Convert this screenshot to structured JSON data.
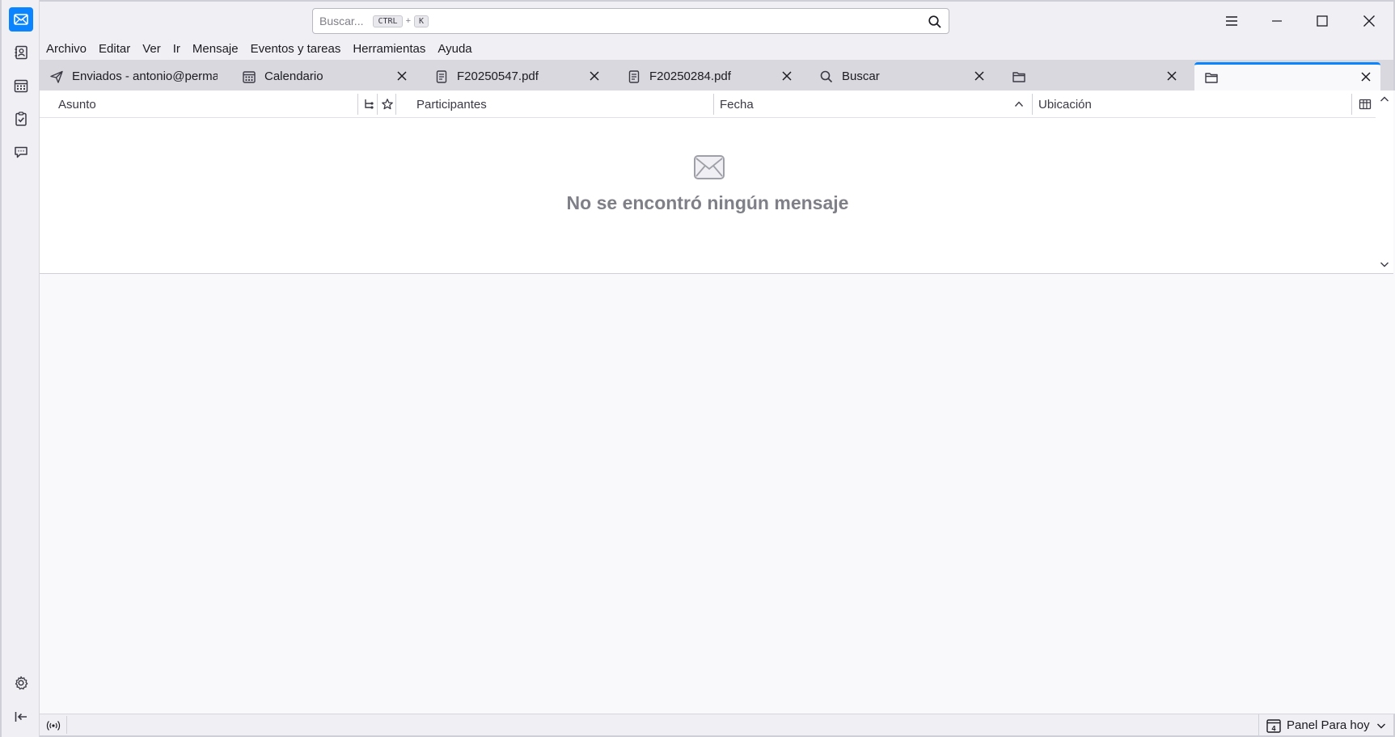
{
  "search": {
    "placeholder": "Buscar...",
    "shortcut_ctrl": "CTRL",
    "shortcut_plus": "+",
    "shortcut_key": "K"
  },
  "menu": {
    "items": [
      "Archivo",
      "Editar",
      "Ver",
      "Ir",
      "Mensaje",
      "Eventos y tareas",
      "Herramientas",
      "Ayuda"
    ]
  },
  "tabs": [
    {
      "label": "Enviados - antonio@perma",
      "icon": "send-icon"
    },
    {
      "label": "Calendario",
      "icon": "calendar-icon"
    },
    {
      "label": "F20250547.pdf",
      "icon": "document-icon"
    },
    {
      "label": "F20250284.pdf",
      "icon": "document-icon"
    },
    {
      "label": "Buscar",
      "icon": "search-icon"
    },
    {
      "label": "",
      "icon": "folder-icon"
    },
    {
      "label": "",
      "icon": "folder-icon",
      "selected": true
    }
  ],
  "columns": {
    "subject": "Asunto",
    "participants": "Participantes",
    "date": "Fecha",
    "location": "Ubicación"
  },
  "empty_state": {
    "message": "No se encontró ningún mensaje"
  },
  "statusbar": {
    "today_pane_label": "Panel Para hoy",
    "today_day": "4"
  },
  "colors": {
    "accent": "#0a84ff",
    "empty_text": "#7f7f88"
  }
}
